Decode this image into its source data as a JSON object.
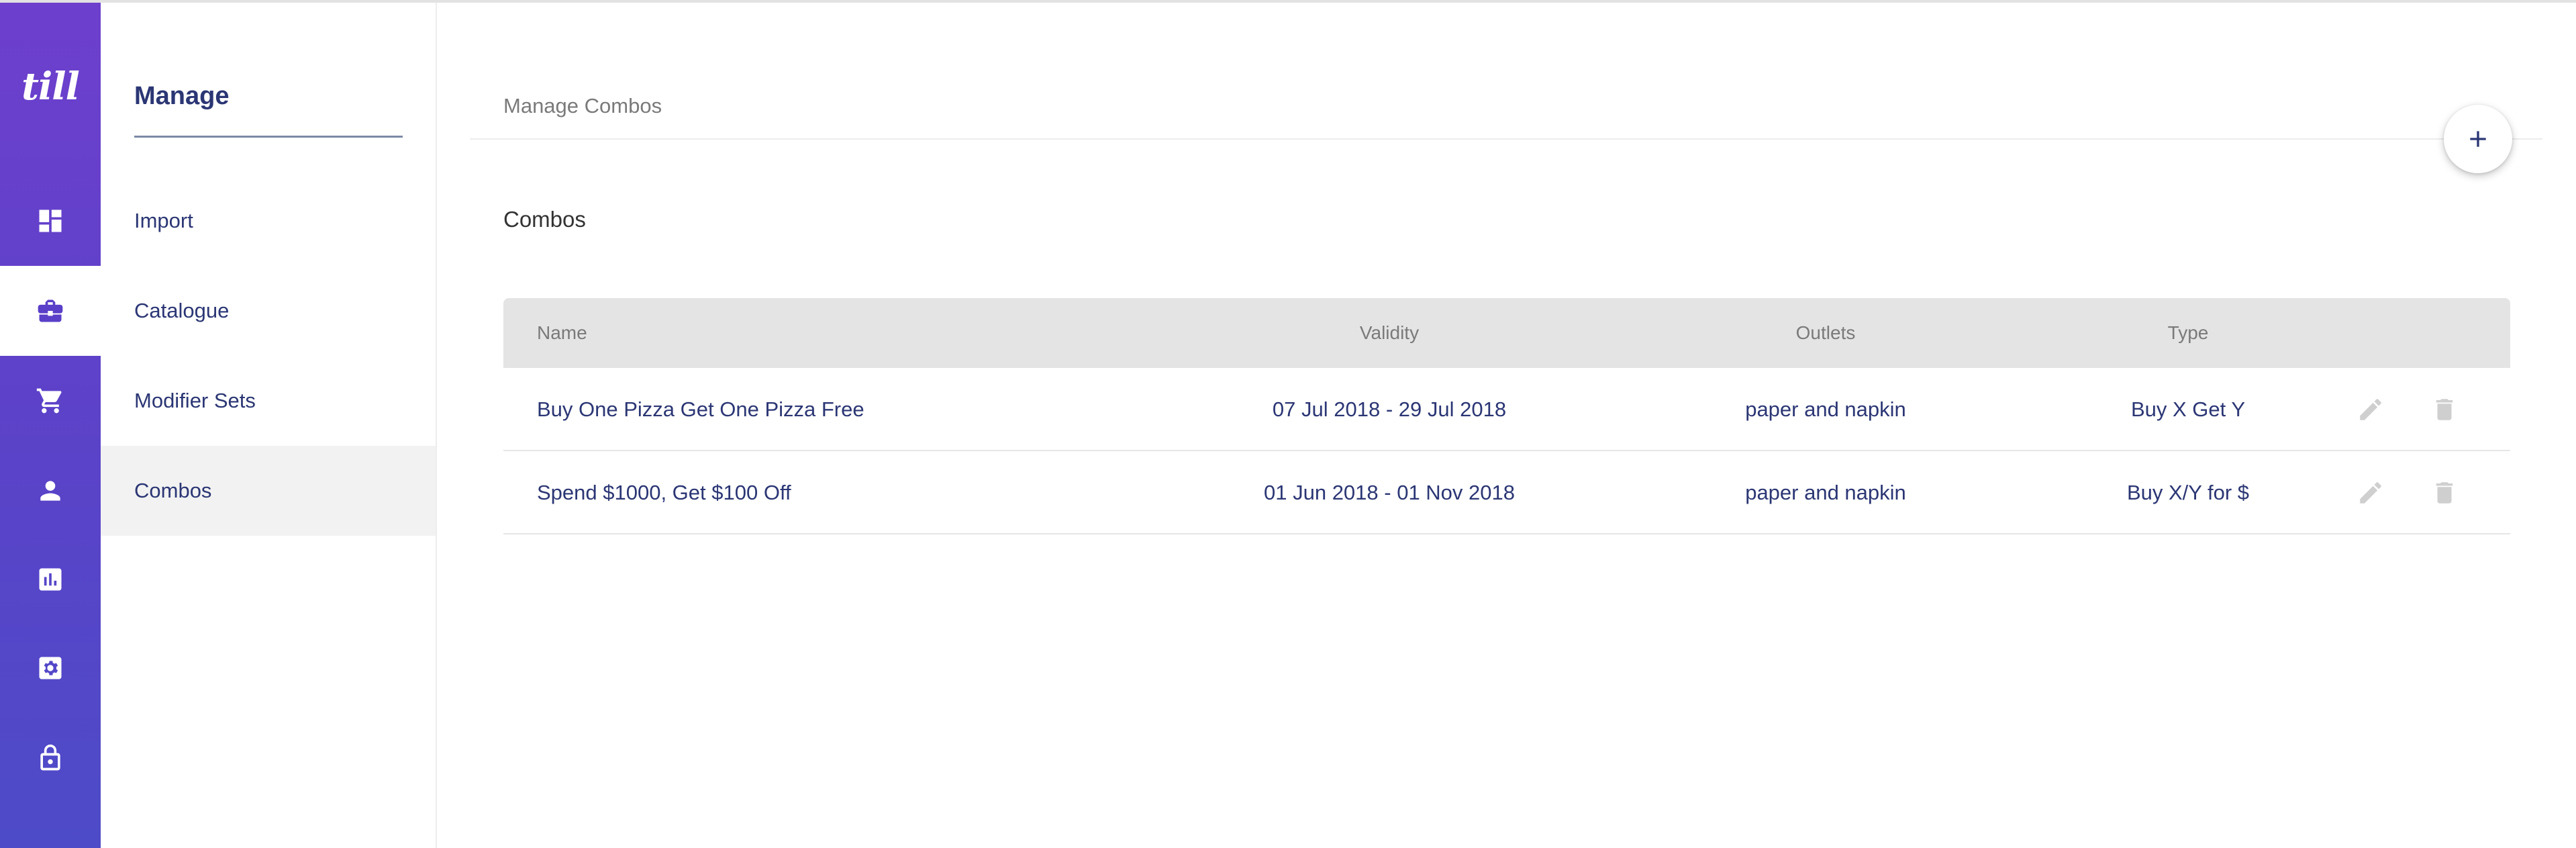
{
  "brand": {
    "logo_text": "till",
    "accent": "#5a3fc8",
    "text_color": "#2b3674"
  },
  "rail": {
    "items": [
      {
        "icon": "dashboard-icon",
        "active": false
      },
      {
        "icon": "briefcase-icon",
        "active": true
      },
      {
        "icon": "cart-icon",
        "active": false
      },
      {
        "icon": "person-icon",
        "active": false
      },
      {
        "icon": "bar-chart-icon",
        "active": false
      },
      {
        "icon": "settings-icon",
        "active": false
      },
      {
        "icon": "lock-icon",
        "active": false
      }
    ]
  },
  "subnav": {
    "title": "Manage",
    "items": [
      {
        "label": "Import",
        "active": false
      },
      {
        "label": "Catalogue",
        "active": false
      },
      {
        "label": "Modifier Sets",
        "active": false
      },
      {
        "label": "Combos",
        "active": true
      }
    ]
  },
  "main": {
    "breadcrumb": "Manage Combos",
    "section_title": "Combos",
    "add_icon": "plus-icon"
  },
  "table": {
    "columns": {
      "name": "Name",
      "validity": "Validity",
      "outlets": "Outlets",
      "type": "Type"
    },
    "rows": [
      {
        "name": "Buy One Pizza Get One Pizza Free",
        "validity": "07 Jul 2018 - 29 Jul 2018",
        "outlets": "paper and napkin",
        "type": "Buy X Get Y"
      },
      {
        "name": "Spend $1000, Get $100 Off",
        "validity": "01 Jun 2018 - 01 Nov 2018",
        "outlets": "paper and napkin",
        "type": "Buy X/Y for $"
      }
    ],
    "row_action_icons": [
      "pencil-icon",
      "trash-icon"
    ]
  }
}
